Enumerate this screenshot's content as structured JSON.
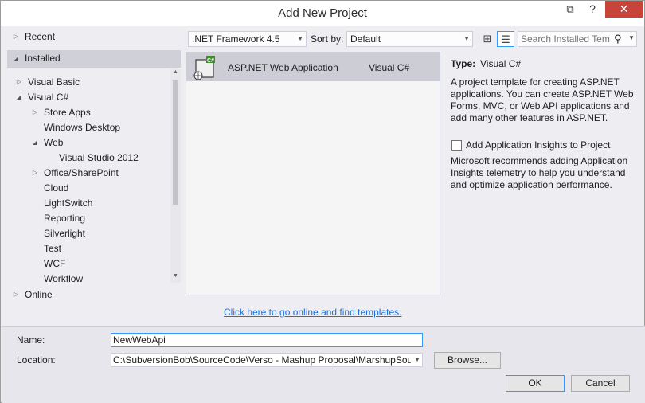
{
  "window": {
    "title": "Add New Project",
    "buttons": {
      "restore": "⧉",
      "help": "?",
      "close": "✕"
    }
  },
  "sidebar": {
    "recent": "Recent",
    "installed": "Installed",
    "online": "Online",
    "tree": [
      "Visual Basic",
      "Visual C#",
      "Store Apps",
      "Windows Desktop",
      "Web",
      "Visual Studio 2012",
      "Office/SharePoint",
      "Cloud",
      "LightSwitch",
      "Reporting",
      "Silverlight",
      "Test",
      "WCF",
      "Workflow"
    ]
  },
  "toolbar": {
    "framework": ".NET Framework 4.5",
    "sort_by_label": "Sort by:",
    "sort_by_value": "Default",
    "search_placeholder": "Search Installed Tem",
    "icons": {
      "grid_view": "grid-view-icon",
      "list_view": "list-view-icon",
      "search": "search-icon"
    }
  },
  "templates": [
    {
      "name": "ASP.NET Web Application",
      "language": "Visual C#",
      "icon_badge": "C#"
    }
  ],
  "online_link": "Click here to go online and find templates.",
  "details": {
    "type_label": "Type:",
    "type_value": "Visual C#",
    "description": "A project template for creating ASP.NET applications. You can create ASP.NET Web Forms, MVC,  or Web API applications and add many other features in ASP.NET.",
    "insights_label": "Add Application Insights to Project",
    "insights_checked": false,
    "insights_description": "Microsoft recommends adding Application Insights telemetry to help you understand and optimize application performance."
  },
  "form": {
    "name_label": "Name:",
    "name_value": "NewWebApi",
    "location_label": "Location:",
    "location_value": "C:\\SubversionBob\\SourceCode\\Verso - Mashup Proposal\\MarshupSourc",
    "browse_label": "Browse...",
    "ok_label": "OK",
    "cancel_label": "Cancel"
  },
  "colors": {
    "accent": "#3399ff",
    "close_button": "#c7443a",
    "link": "#1e6fd9",
    "selection": "#cdcdd6"
  }
}
